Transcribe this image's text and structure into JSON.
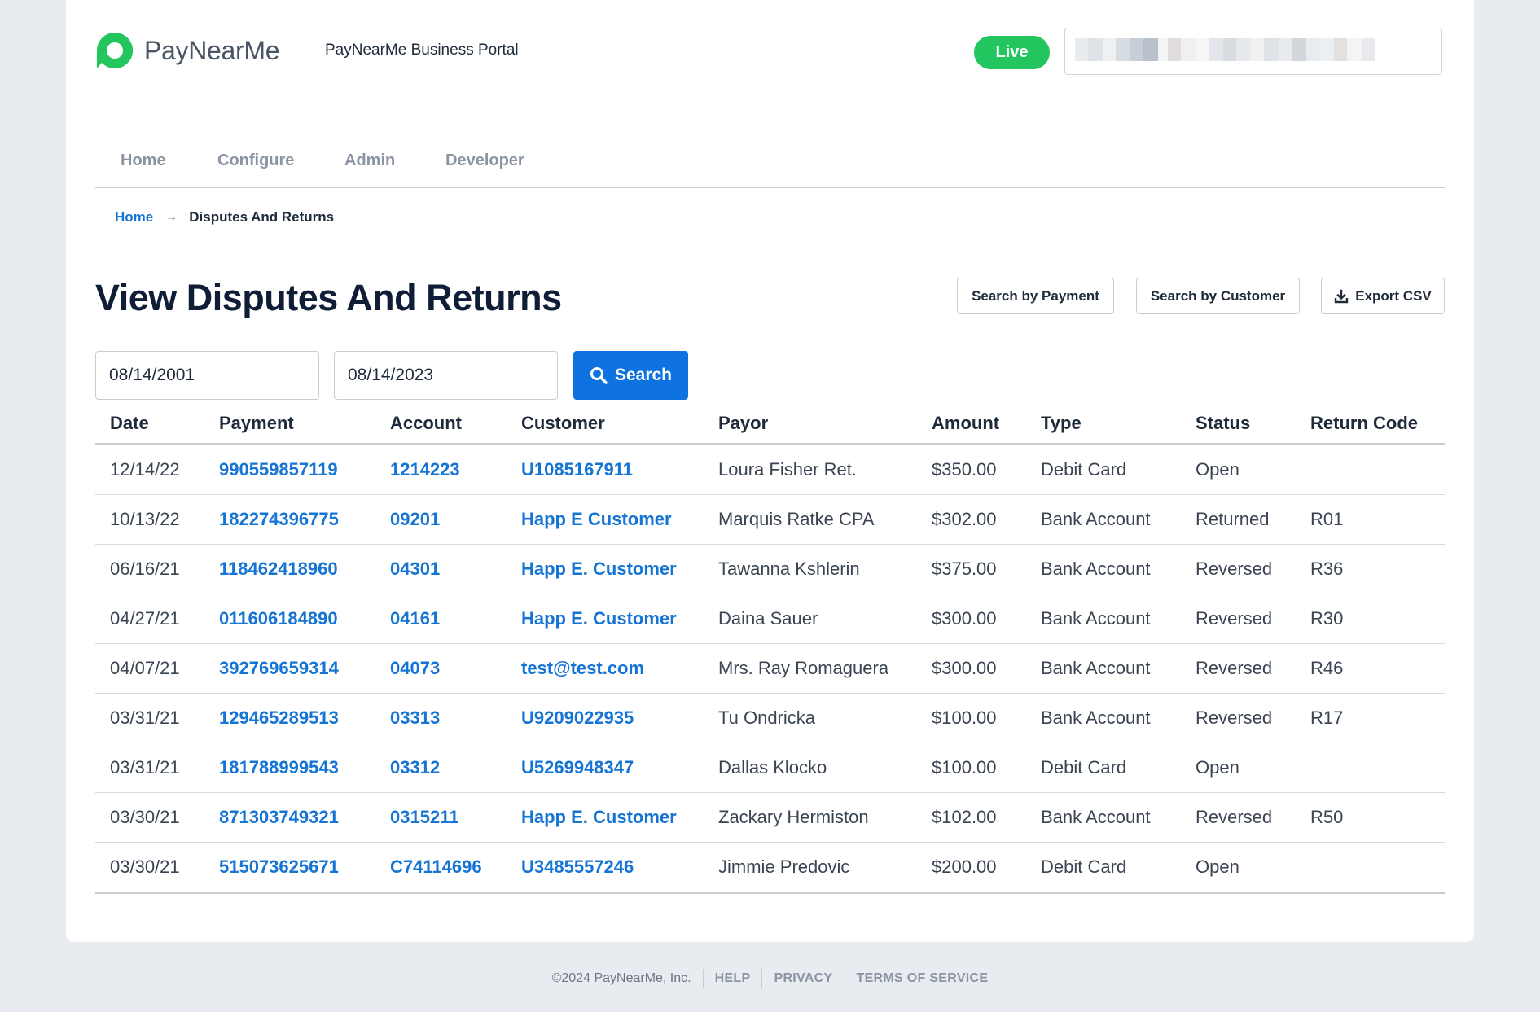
{
  "brand": {
    "name": "PayNearMe",
    "portal_title": "PayNearMe Business Portal",
    "accent_color": "#22c55e",
    "link_color": "#1574d4",
    "primary_button_color": "#0e72e0"
  },
  "header": {
    "live_label": "Live"
  },
  "nav": {
    "items": [
      {
        "label": "Home"
      },
      {
        "label": "Configure"
      },
      {
        "label": "Admin"
      },
      {
        "label": "Developer"
      }
    ]
  },
  "breadcrumb": {
    "home": "Home",
    "arrow": "→",
    "current": "Disputes And Returns"
  },
  "page": {
    "title": "View Disputes And Returns",
    "search_by_payment": "Search by Payment",
    "search_by_customer": "Search by Customer",
    "export_csv": "Export CSV"
  },
  "filters": {
    "start_date": "08/14/2001",
    "end_date": "08/14/2023",
    "search_label": "Search"
  },
  "table": {
    "columns": [
      "Date",
      "Payment",
      "Account",
      "Customer",
      "Payor",
      "Amount",
      "Type",
      "Status",
      "Return Code"
    ],
    "rows": [
      [
        "12/14/22",
        "990559857119",
        "1214223",
        "U1085167911",
        "Loura Fisher Ret.",
        "$350.00",
        "Debit Card",
        "Open",
        ""
      ],
      [
        "10/13/22",
        "182274396775",
        "09201",
        "Happ E Customer",
        "Marquis Ratke CPA",
        "$302.00",
        "Bank Account",
        "Returned",
        "R01"
      ],
      [
        "06/16/21",
        "118462418960",
        "04301",
        "Happ E. Customer",
        "Tawanna Kshlerin",
        "$375.00",
        "Bank Account",
        "Reversed",
        "R36"
      ],
      [
        "04/27/21",
        "011606184890",
        "04161",
        "Happ E. Customer",
        "Daina Sauer",
        "$300.00",
        "Bank Account",
        "Reversed",
        "R30"
      ],
      [
        "04/07/21",
        "392769659314",
        "04073",
        "test@test.com",
        "Mrs. Ray Romaguera",
        "$300.00",
        "Bank Account",
        "Reversed",
        "R46"
      ],
      [
        "03/31/21",
        "129465289513",
        "03313",
        "U9209022935",
        "Tu Ondricka",
        "$100.00",
        "Bank Account",
        "Reversed",
        "R17"
      ],
      [
        "03/31/21",
        "181788999543",
        "03312",
        "U5269948347",
        "Dallas Klocko",
        "$100.00",
        "Debit Card",
        "Open",
        ""
      ],
      [
        "03/30/21",
        "871303749321",
        "0315211",
        "Happ E. Customer",
        "Zackary Hermiston",
        "$102.00",
        "Bank Account",
        "Reversed",
        "R50"
      ],
      [
        "03/30/21",
        "515073625671",
        "C74114696",
        "U3485557246",
        "Jimmie Predovic",
        "$200.00",
        "Debit Card",
        "Open",
        ""
      ]
    ]
  },
  "footer": {
    "copyright": "©2024 PayNearMe, Inc.",
    "help": "HELP",
    "privacy": "PRIVACY",
    "terms": "TERMS OF SERVICE"
  }
}
